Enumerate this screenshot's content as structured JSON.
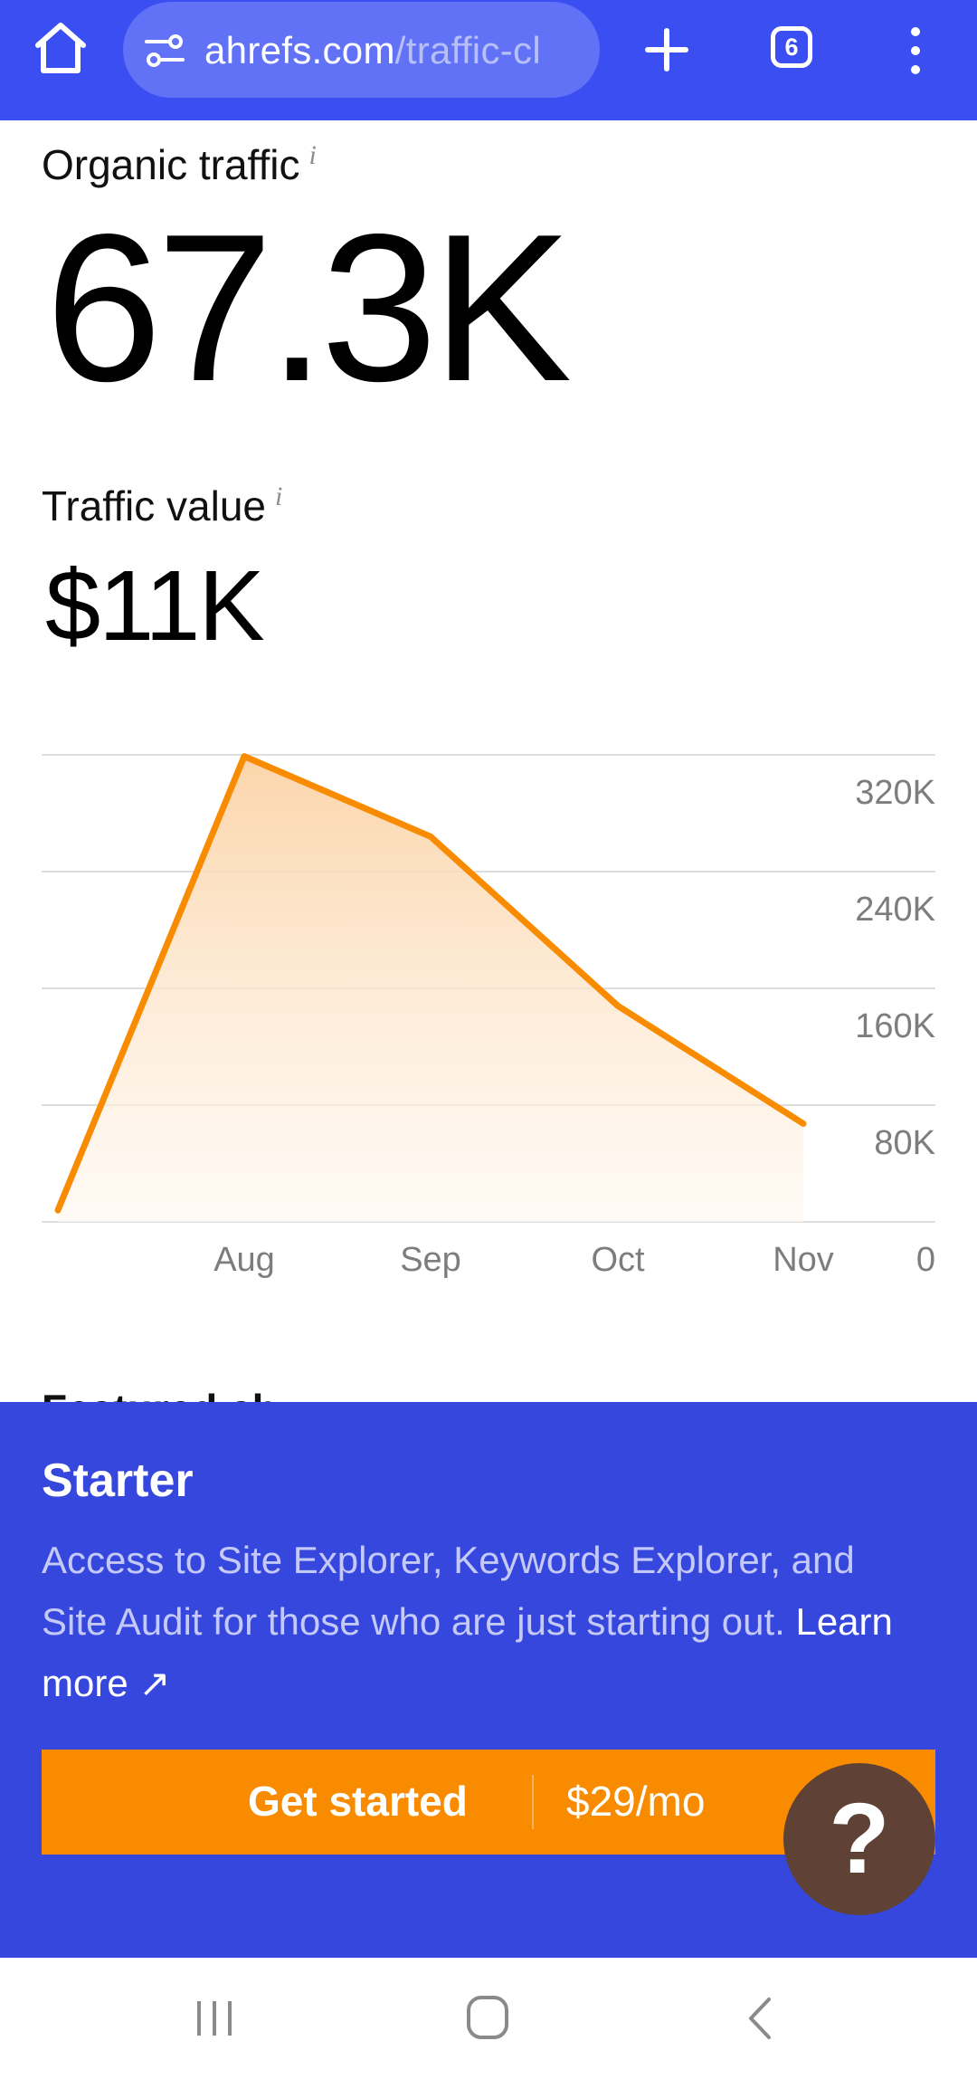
{
  "browser": {
    "url_domain": "ahrefs.com",
    "url_path": "/traffic-cl",
    "tab_count": "6"
  },
  "metrics": {
    "organic_traffic_label": "Organic traffic",
    "organic_traffic_value": "67.3K",
    "traffic_value_label": "Traffic value",
    "traffic_value_value": "$11K",
    "info_glyph": "i"
  },
  "chart_data": {
    "type": "area",
    "x": [
      "",
      "Aug",
      "Sep",
      "Oct",
      "Nov"
    ],
    "values": [
      8000,
      319000,
      264000,
      148000,
      67300
    ],
    "x_tick_labels": [
      "Aug",
      "Sep",
      "Oct",
      "Nov"
    ],
    "y_tick_labels": [
      "320K",
      "240K",
      "160K",
      "80K",
      "0"
    ],
    "y_ticks": [
      320000,
      240000,
      160000,
      80000,
      0
    ],
    "ylim": [
      0,
      320000
    ],
    "grid": true,
    "line_color": "#f98b00",
    "fill_color": "#fbd3a6"
  },
  "section_peek": {
    "text": "Featured ch"
  },
  "promo": {
    "title": "Starter",
    "description": "Access to Site Explorer, Keywords Explorer, and Site Audit for those who are just starting out.",
    "learn_more": "Learn more ↗",
    "cta_label": "Get started",
    "cta_price": "$29/mo",
    "help_glyph": "?"
  },
  "colors": {
    "browser_blue": "#3b4ef2",
    "promo_blue": "#3647de",
    "accent_orange": "#f98b00",
    "help_brown": "#5f4136"
  }
}
